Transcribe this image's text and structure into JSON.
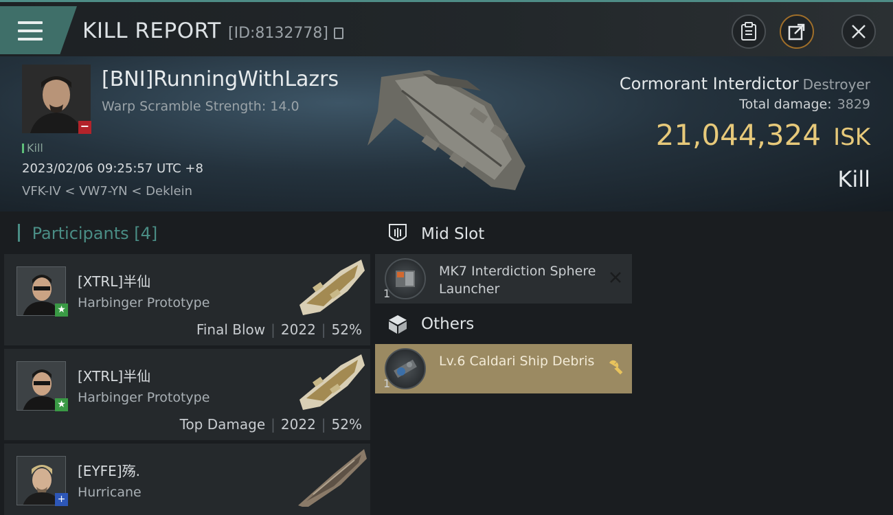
{
  "header": {
    "title": "KILL REPORT",
    "report_id": "[ID:8132778]",
    "icons": [
      "menu-icon",
      "copy-icon",
      "clipboard-icon",
      "share-icon",
      "close-icon"
    ]
  },
  "victim": {
    "name": "[BNI]RunningWithLazrs",
    "subtitle": "Warp Scramble Strength: 14.0",
    "tag": "Kill",
    "datetime": "2023/02/06 09:25:57 UTC +8",
    "location": "VFK-IV < VW7-YN < Deklein",
    "ship_name": "Cormorant Interdictor",
    "ship_class": "Destroyer",
    "total_damage_label": "Total damage:",
    "total_damage": "3829",
    "isk_value": "21,044,324",
    "isk_unit": "ISK",
    "result": "Kill",
    "badge": "−"
  },
  "participants": {
    "label": "Participants",
    "count": "[4]",
    "rows": [
      {
        "name": "[XTRL]半仙",
        "ship": "Harbinger Prototype",
        "role": "Final Blow",
        "damage": "2022",
        "percent": "52%",
        "badge": "★",
        "badge_color": "#3a9a45"
      },
      {
        "name": "[XTRL]半仙",
        "ship": "Harbinger Prototype",
        "role": "Top Damage",
        "damage": "2022",
        "percent": "52%",
        "badge": "★",
        "badge_color": "#3a9a45"
      },
      {
        "name": "[EYFE]殇.",
        "ship": "Hurricane",
        "badge": "+",
        "badge_color": "#2d57b8"
      }
    ]
  },
  "modules": {
    "mid_slot": {
      "title": "Mid Slot",
      "items": [
        {
          "qty": "1",
          "name": "MK7 Interdiction Sphere Launcher",
          "action": "destroyed-x-icon"
        }
      ]
    },
    "others": {
      "title": "Others",
      "items": [
        {
          "qty": "1",
          "name": "Lv.6 Caldari Ship Debris",
          "action": "wrench-icon"
        }
      ]
    }
  },
  "colors": {
    "accent": "#4a8d85",
    "isk": "#e7c97a",
    "dropped_item": "#9b8a62",
    "victim_badge": "#b3232a"
  }
}
